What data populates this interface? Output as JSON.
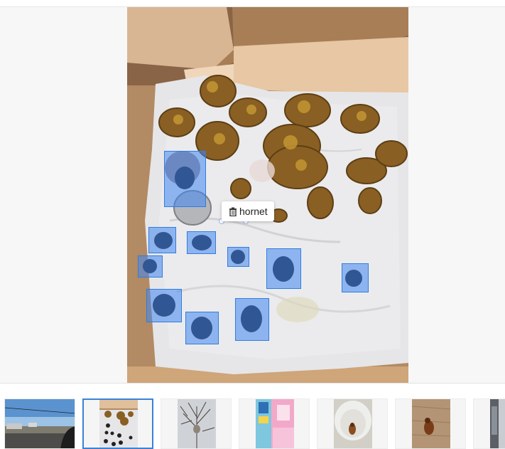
{
  "annotation": {
    "label": "hornet",
    "delete_icon": "trash-icon",
    "box_color": "#4187f0"
  },
  "photo": {
    "subject": "hornets-and-nest-debris-on-paper-towel"
  },
  "thumbnails": [
    {
      "name": "thumb-road-scene",
      "selected": false
    },
    {
      "name": "thumb-hornets-on-towel",
      "selected": true
    },
    {
      "name": "thumb-bare-tree",
      "selected": false
    },
    {
      "name": "thumb-pink-playset",
      "selected": false
    },
    {
      "name": "thumb-hornet-in-cup",
      "selected": false
    },
    {
      "name": "thumb-hornet-on-wood",
      "selected": false
    },
    {
      "name": "thumb-building-edge",
      "selected": false
    }
  ]
}
